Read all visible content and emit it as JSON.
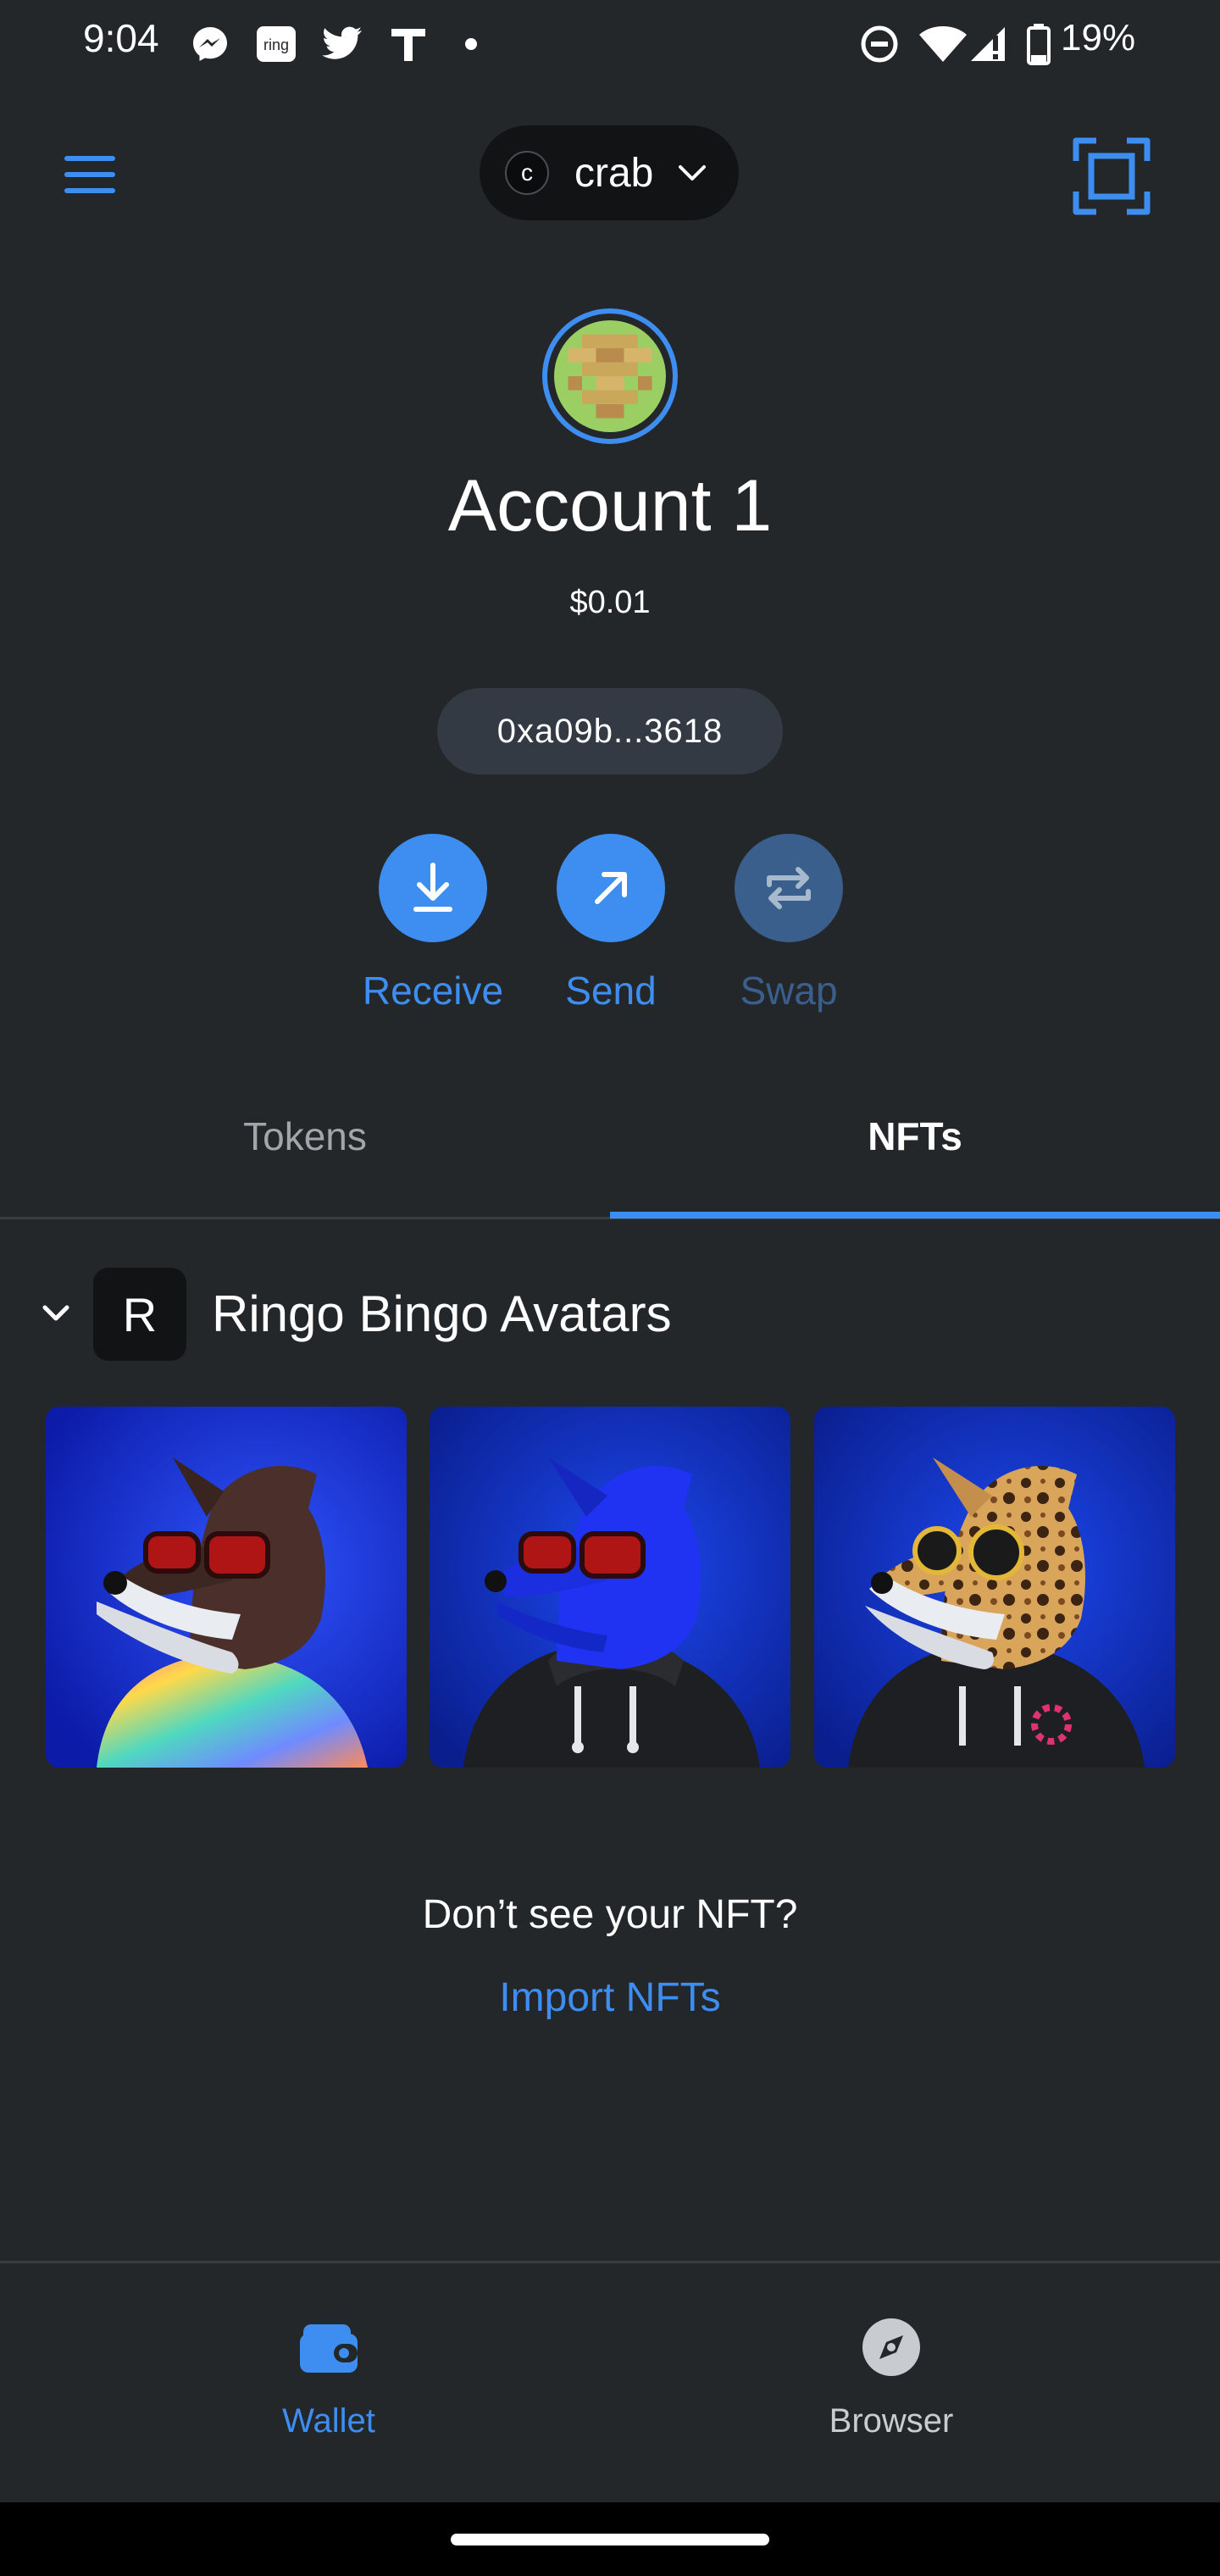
{
  "status_bar": {
    "time": "9:04",
    "battery": "19%",
    "notification_icons": [
      "messenger-icon",
      "ring-icon",
      "twitter-icon",
      "t-app-icon",
      "dot-icon"
    ],
    "system_icons": [
      "do-not-disturb-icon",
      "wifi-icon",
      "signal-icon",
      "battery-icon"
    ]
  },
  "header": {
    "network_initial": "c",
    "network_name": "crab"
  },
  "account": {
    "name": "Account 1",
    "balance": "$0.01",
    "address": "0xa09b...3618"
  },
  "actions": [
    {
      "label": "Receive",
      "enabled": true
    },
    {
      "label": "Send",
      "enabled": true
    },
    {
      "label": "Swap",
      "enabled": false
    }
  ],
  "tabs": [
    {
      "label": "Tokens",
      "active": false
    },
    {
      "label": "NFTs",
      "active": true
    }
  ],
  "collection": {
    "initial": "R",
    "name": "Ringo Bingo Avatars",
    "items": [
      {
        "description": "brown dog with red sunglasses and tie-dye shirt"
      },
      {
        "description": "blue dog with red sunglasses and black hoodie"
      },
      {
        "description": "leopard with gold round glasses and black hoodie"
      }
    ]
  },
  "empty_state": {
    "question": "Don’t see your NFT?",
    "import_link": "Import NFTs"
  },
  "bottom_nav": [
    {
      "label": "Wallet",
      "active": true,
      "icon": "wallet-icon"
    },
    {
      "label": "Browser",
      "active": false,
      "icon": "compass-icon"
    }
  ],
  "colors": {
    "background": "#24272a",
    "accent": "#3d8ef0",
    "button_disabled": "#3b5f8c",
    "pill_dark": "#121314",
    "address_pill": "#343a44"
  }
}
